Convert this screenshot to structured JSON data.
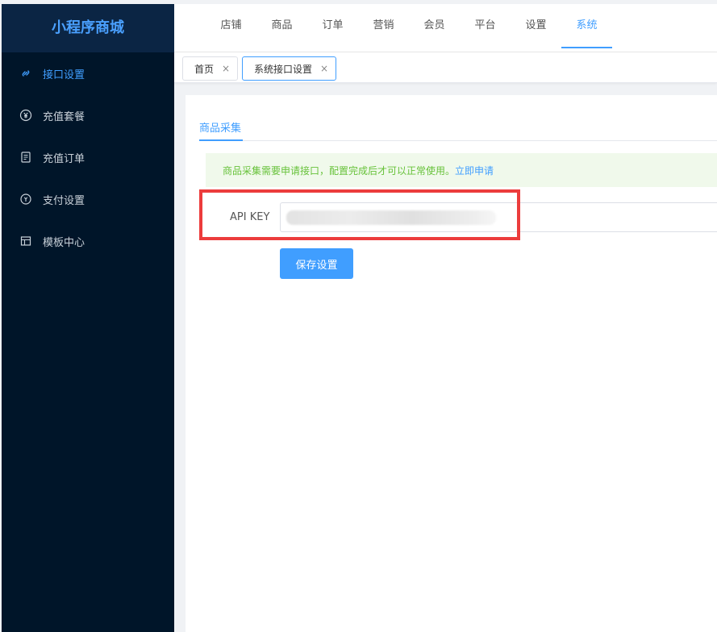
{
  "app": {
    "title": "小程序商城"
  },
  "sidebar": {
    "items": [
      {
        "label": "接口设置",
        "icon": "link-icon",
        "active": true
      },
      {
        "label": "充值套餐",
        "icon": "yen-circle-icon",
        "active": false
      },
      {
        "label": "充值订单",
        "icon": "document-icon",
        "active": false
      },
      {
        "label": "支付设置",
        "icon": "payment-icon",
        "active": false
      },
      {
        "label": "模板中心",
        "icon": "template-icon",
        "active": false
      }
    ]
  },
  "topnav": {
    "items": [
      "店铺",
      "商品",
      "订单",
      "营销",
      "会员",
      "平台",
      "设置",
      "系统"
    ],
    "active_index": 7
  },
  "tabs": {
    "items": [
      {
        "label": "首页",
        "close": "×"
      },
      {
        "label": "系统接口设置",
        "close": "×"
      }
    ]
  },
  "content": {
    "subtab": "商品采集",
    "alert": {
      "text": "商品采集需要申请接口，配置完成后才可以正常使用。",
      "link": "立即申请"
    },
    "form": {
      "label": "API KEY",
      "value": ""
    },
    "save_label": "保存设置"
  },
  "colors": {
    "sidebar_bg": "#001529",
    "accent": "#409eff",
    "alert_bg": "#f0f9eb",
    "alert_text": "#67c23a",
    "highlight": "#ec3c3c"
  }
}
